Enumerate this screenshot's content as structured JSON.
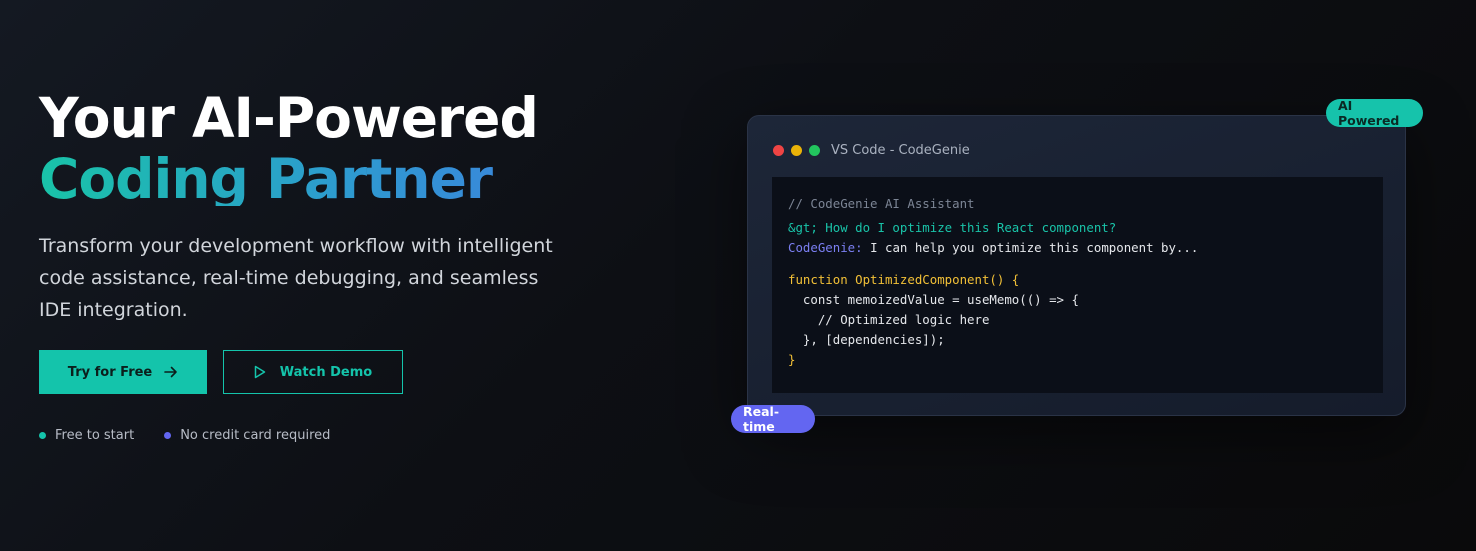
{
  "hero": {
    "headline_line1": "Your AI-Powered",
    "headline_line2": "Coding Partner",
    "subtitle": "Transform your development workflow with intelligent code assistance, real-time debugging, and seamless IDE integration.",
    "primary_cta": {
      "label": "Try for Free",
      "icon": "arrow-right-icon"
    },
    "secondary_cta": {
      "label": "Watch Demo",
      "icon": "play-icon"
    },
    "perks": [
      {
        "label": "Free to start",
        "color": "#14c4ab"
      },
      {
        "label": "No credit card required",
        "color": "#6366f1"
      }
    ]
  },
  "ide": {
    "window_title": "VS Code - CodeGenie",
    "window_dots": [
      "#ef4444",
      "#eab308",
      "#22c55e"
    ],
    "code": {
      "comment": "// CodeGenie AI Assistant",
      "prompt": "&gt; How do I optimize this React component?",
      "agent_name": "CodeGenie:",
      "agent_reply": " I can help you optimize this component by...",
      "line_fn": "function OptimizedComponent() {",
      "line_memo": "  const memoizedValue = useMemo(() => {",
      "line_inner_comment": "    // Optimized logic here",
      "line_deps": "  }, [dependencies]);",
      "line_close": "}"
    }
  },
  "badges": {
    "ai": "AI Powered",
    "realtime": "Real-time"
  },
  "colors": {
    "accent_teal": "#14c4ab",
    "accent_indigo": "#6366f1",
    "code_yellow": "#f2c037"
  }
}
